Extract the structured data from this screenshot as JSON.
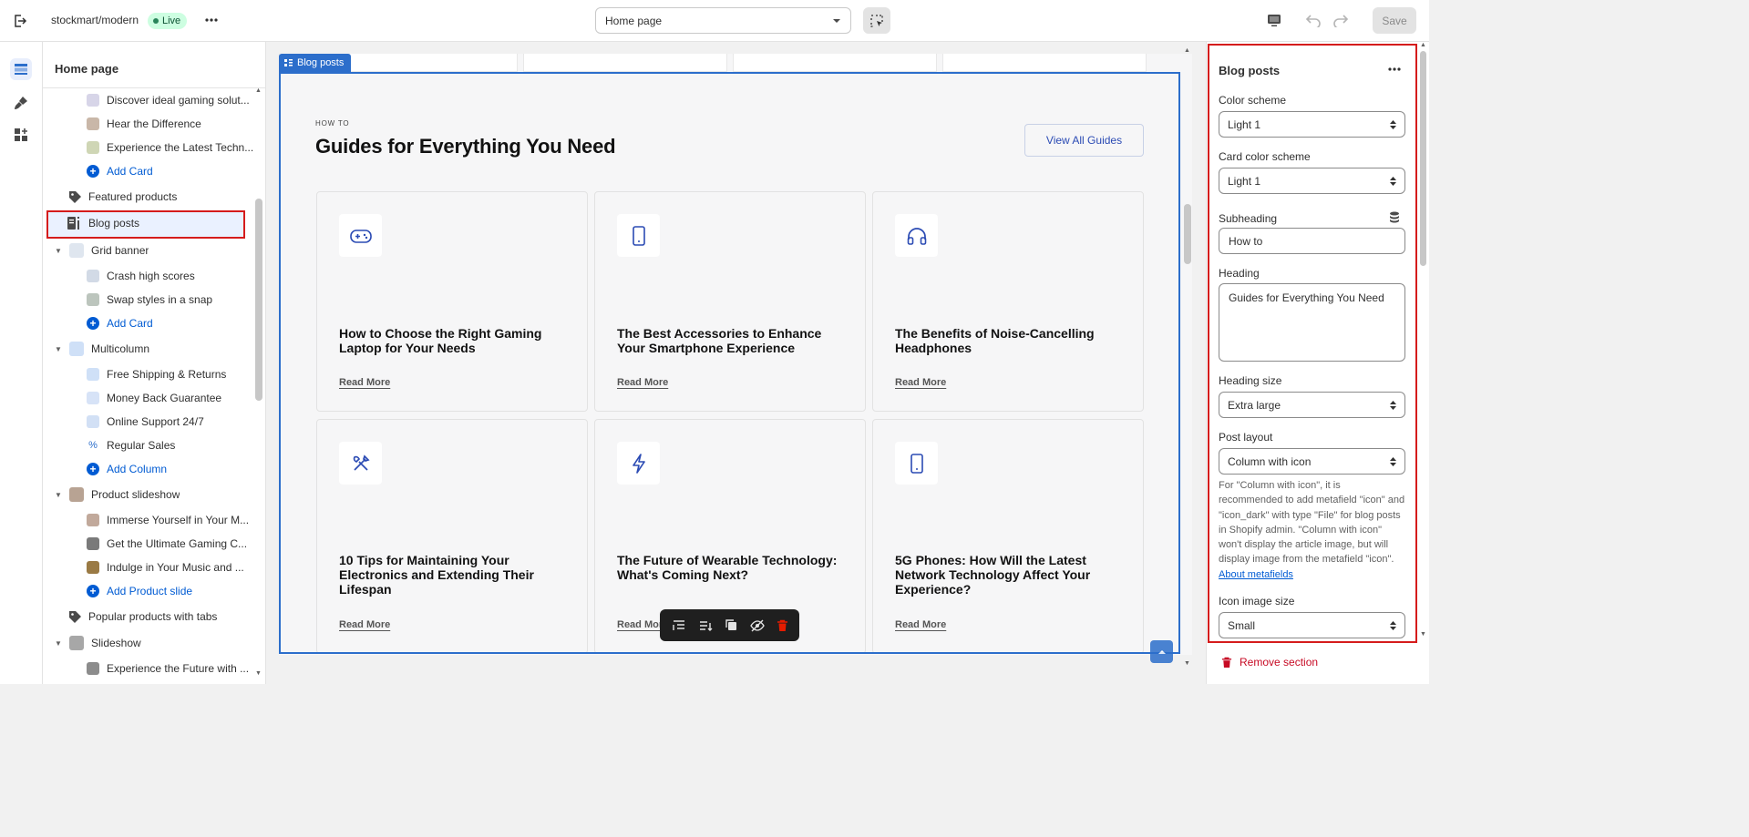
{
  "topbar": {
    "store_name": "stockmart/modern",
    "live_badge": "Live",
    "page_select_value": "Home page",
    "save_label": "Save"
  },
  "sidebar": {
    "title": "Home page",
    "rows": [
      {
        "label": "Discover ideal gaming solut...",
        "kind": "child"
      },
      {
        "label": "Hear the Difference",
        "kind": "child"
      },
      {
        "label": "Experience the Latest Techn...",
        "kind": "child"
      },
      {
        "label": "Add Card",
        "kind": "add"
      },
      {
        "label": "Featured products",
        "kind": "section"
      },
      {
        "label": "Blog posts",
        "kind": "section"
      },
      {
        "label": "Grid banner",
        "kind": "group"
      },
      {
        "label": "Crash high scores",
        "kind": "child"
      },
      {
        "label": "Swap styles in a snap",
        "kind": "child"
      },
      {
        "label": "Add Card",
        "kind": "add"
      },
      {
        "label": "Multicolumn",
        "kind": "group"
      },
      {
        "label": "Free Shipping & Returns",
        "kind": "child"
      },
      {
        "label": "Money Back Guarantee",
        "kind": "child"
      },
      {
        "label": "Online Support 24/7",
        "kind": "child"
      },
      {
        "label": "Regular Sales",
        "kind": "child"
      },
      {
        "label": "Add Column",
        "kind": "add"
      },
      {
        "label": "Product slideshow",
        "kind": "group"
      },
      {
        "label": "Immerse Yourself in Your M...",
        "kind": "child"
      },
      {
        "label": "Get the Ultimate Gaming C...",
        "kind": "child"
      },
      {
        "label": "Indulge in Your Music and ...",
        "kind": "child"
      },
      {
        "label": "Add Product slide",
        "kind": "add"
      },
      {
        "label": "Popular products with tabs",
        "kind": "section"
      },
      {
        "label": "Slideshow",
        "kind": "group"
      },
      {
        "label": "Experience the Future with ...",
        "kind": "child"
      }
    ]
  },
  "canvas": {
    "selection_tag": "Blog posts",
    "subheading": "HOW TO",
    "heading": "Guides for Everything You Need",
    "view_all_label": "View All Guides",
    "cards": [
      {
        "icon": "gamepad-icon",
        "title": "How to Choose the Right Gaming Laptop for Your Needs",
        "read_more": "Read More"
      },
      {
        "icon": "smartphone-icon",
        "title": "The Best Accessories to Enhance Your Smartphone Experience",
        "read_more": "Read More"
      },
      {
        "icon": "headphones-icon",
        "title": "The Benefits of Noise-Cancelling Headphones",
        "read_more": "Read More"
      },
      {
        "icon": "tools-icon",
        "title": "10 Tips for Maintaining Your Electronics and Extending Their Lifespan",
        "read_more": "Read More"
      },
      {
        "icon": "lightning-icon",
        "title": "The Future of Wearable Technology: What's Coming Next?",
        "read_more": "Read More"
      },
      {
        "icon": "smartphone-icon",
        "title": "5G Phones: How Will the Latest Network Technology Affect Your Experience?",
        "read_more": "Read More"
      }
    ]
  },
  "settings": {
    "title": "Blog posts",
    "color_scheme_label": "Color scheme",
    "color_scheme_value": "Light 1",
    "card_color_scheme_label": "Card color scheme",
    "card_color_scheme_value": "Light 1",
    "subheading_label": "Subheading",
    "subheading_value": "How to",
    "heading_label": "Heading",
    "heading_value": "Guides for Everything You Need",
    "heading_size_label": "Heading size",
    "heading_size_value": "Extra large",
    "post_layout_label": "Post layout",
    "post_layout_value": "Column with icon",
    "help_text": "For \"Column with icon\", it is recommended to add metafield \"icon\" and \"icon_dark\" with type \"File\" for blog posts in Shopify admin. \"Column with icon\" won't display the article image, but will display image from the metafield \"icon\".",
    "help_link": "About metafields",
    "icon_image_size_label": "Icon image size",
    "icon_image_size_value": "Small",
    "remove_section_label": "Remove section"
  },
  "colors": {
    "accent_blue": "#2c6ecb",
    "highlight_red": "#d51c1c",
    "live_green": "#29845a",
    "icon_blue": "#2b4bb4"
  }
}
